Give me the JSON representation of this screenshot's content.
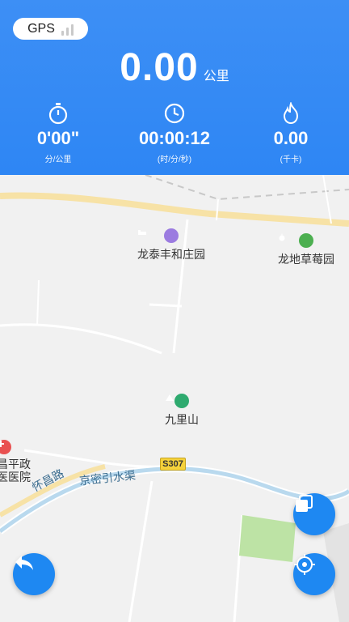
{
  "gps": {
    "label": "GPS"
  },
  "distance": {
    "value": "0.00",
    "unit": "公里"
  },
  "stats": [
    {
      "icon": "stopwatch-icon",
      "value": "0'00\"",
      "label": "分/公里"
    },
    {
      "icon": "clock-icon",
      "value": "00:00:12",
      "label": "(时/分/秒)"
    },
    {
      "icon": "flame-icon",
      "value": "0.00",
      "label": "(千卡)"
    }
  ],
  "map": {
    "pois": [
      {
        "name": "龙泰丰和庄园",
        "icon": "hotel-icon",
        "color": "#9b7be0"
      },
      {
        "name": "龙地草莓园",
        "icon": "fruit-icon",
        "color": "#4caf50"
      },
      {
        "name": "九里山",
        "icon": "mountain-icon",
        "color": "#2eaa6f"
      },
      {
        "name": "昌平政\n医医院",
        "icon": "hospital-icon",
        "color": "#e95151"
      }
    ],
    "roads": {
      "huaichang": "怀昌路",
      "canal": "京密引水渠",
      "shield": "S307"
    }
  },
  "colors": {
    "header": "#2e86f4",
    "fab": "#1e88f2"
  }
}
